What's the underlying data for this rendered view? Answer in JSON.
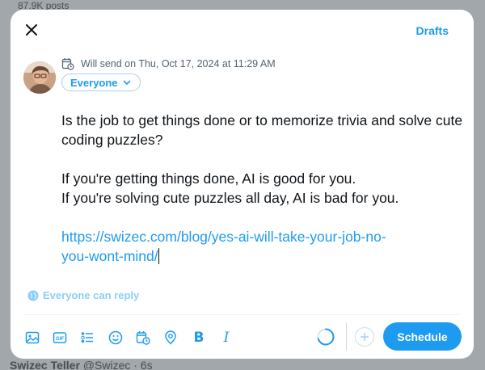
{
  "background": {
    "top_count": "87.9K posts",
    "bottom_name": "Swizec Teller",
    "bottom_handle": "@Swizec · 6s"
  },
  "modal": {
    "close_icon": "close-icon",
    "drafts_label": "Drafts",
    "schedule_text": "Will send on Thu, Oct 17, 2024 at 11:29 AM",
    "audience_label": "Everyone",
    "reply_label": "Everyone can reply"
  },
  "post": {
    "para1": "Is the job to get things done or to memorize trivia and solve cute coding puzzles?",
    "para2_line1": "If you're getting things done, AI is good for you.",
    "para2_line2": "If you're solving cute puzzles all day, AI is bad for you.",
    "link_line1": "https://swizec.com/blog/yes-ai-will-take-your-job-no-",
    "link_line2": "you-wont-mind/"
  },
  "toolbar": {
    "icons": [
      "image-icon",
      "gif-icon",
      "poll-icon",
      "emoji-icon",
      "schedule-icon",
      "location-icon",
      "bold-icon",
      "italic-icon"
    ],
    "schedule_button": "Schedule",
    "bold_glyph": "B",
    "italic_glyph": "I",
    "gif_glyph": "GIF"
  },
  "colors": {
    "accent": "#1d9bf0",
    "text": "#0f1419",
    "muted": "#536471",
    "reply_disabled": "#8ecdf8"
  }
}
